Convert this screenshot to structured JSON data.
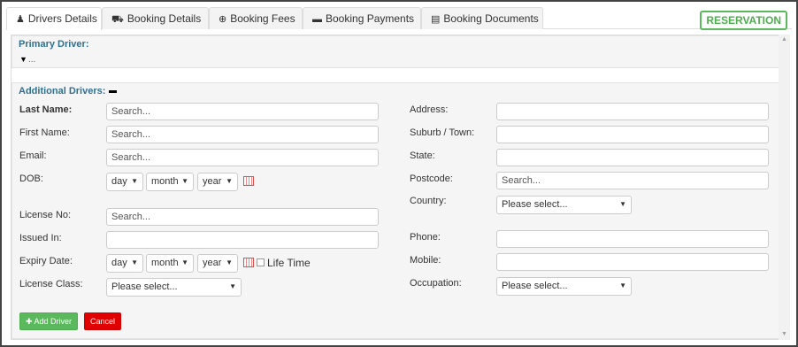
{
  "tabs": [
    {
      "label": "Drivers Details",
      "icon": "user-icon",
      "glyph": "♟"
    },
    {
      "label": "Booking Details",
      "icon": "car-icon",
      "glyph": "⛟"
    },
    {
      "label": "Booking Fees",
      "icon": "plus-circle-icon",
      "glyph": "⊕"
    },
    {
      "label": "Booking Payments",
      "icon": "credit-card-icon",
      "glyph": "▬"
    },
    {
      "label": "Booking Documents",
      "icon": "document-icon",
      "glyph": "▤"
    }
  ],
  "reservation_label": "RESERVATION",
  "primary": {
    "title": "Primary Driver:",
    "collapsed_text": "..."
  },
  "additional": {
    "title": "Additional Drivers:",
    "left": {
      "last_name": {
        "label": "Last Name:",
        "placeholder": "Search..."
      },
      "first_name": {
        "label": "First Name:",
        "placeholder": "Search..."
      },
      "email": {
        "label": "Email:",
        "placeholder": "Search..."
      },
      "dob": {
        "label": "DOB:",
        "day": "day",
        "month": "month",
        "year": "year"
      },
      "license_no": {
        "label": "License No:",
        "placeholder": "Search..."
      },
      "issued_in": {
        "label": "Issued In:"
      },
      "expiry_date": {
        "label": "Expiry Date:",
        "day": "day",
        "month": "month",
        "year": "year",
        "lifetime_label": "Life Time"
      },
      "license_class": {
        "label": "License Class:",
        "value": "Please select..."
      }
    },
    "right": {
      "address": {
        "label": "Address:"
      },
      "suburb": {
        "label": "Suburb / Town:"
      },
      "state": {
        "label": "State:"
      },
      "postcode": {
        "label": "Postcode:",
        "placeholder": "Search..."
      },
      "country": {
        "label": "Country:",
        "value": "Please select..."
      },
      "phone": {
        "label": "Phone:"
      },
      "mobile": {
        "label": "Mobile:"
      },
      "occupation": {
        "label": "Occupation:",
        "value": "Please select..."
      }
    },
    "add_button": "✚ Add Driver",
    "cancel_button": "Cancel"
  },
  "colors": {
    "accent": "#31708f",
    "success": "#5cb85c",
    "danger": "#e00000"
  }
}
